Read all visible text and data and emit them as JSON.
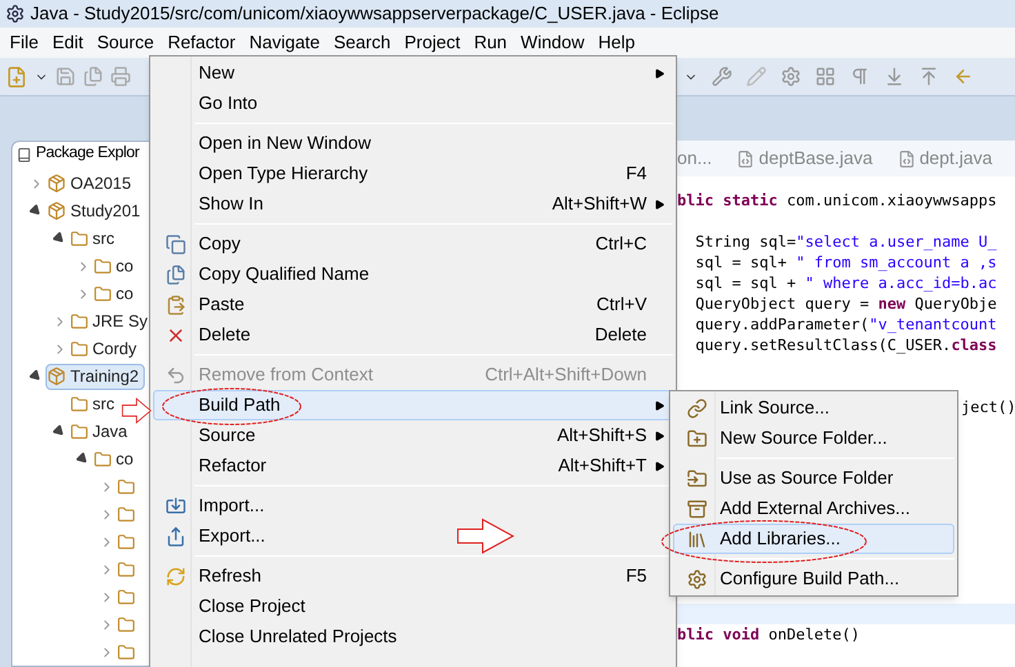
{
  "window": {
    "title": "Java - Study2015/src/com/unicom/xiaoywwsappserverpackage/C_USER.java - Eclipse"
  },
  "menu_bar": [
    "File",
    "Edit",
    "Source",
    "Refactor",
    "Navigate",
    "Search",
    "Project",
    "Run",
    "Window",
    "Help"
  ],
  "package_explorer": {
    "title": "Package Explor",
    "tree": [
      {
        "label": "OA2015",
        "expanded": false,
        "selected": false
      },
      {
        "label": "Study201",
        "expanded": true,
        "selected": false,
        "children": [
          {
            "label": "src",
            "expanded": true,
            "selected": false,
            "children": [
              {
                "label": "co",
                "expanded": false,
                "selected": false
              },
              {
                "label": "co",
                "expanded": false,
                "selected": false
              }
            ]
          },
          {
            "label": "JRE Sy",
            "expanded": false,
            "selected": false
          },
          {
            "label": "Cordy",
            "expanded": false,
            "selected": false
          }
        ]
      },
      {
        "label": "Training2",
        "expanded": true,
        "selected": true,
        "children": [
          {
            "label": "src",
            "selected": false
          },
          {
            "label": "Java",
            "expanded": true,
            "selected": false,
            "children": [
              {
                "label": "co",
                "expanded": true,
                "selected": false,
                "children": [
                  {
                    "expanded": false,
                    "selected": false
                  },
                  {
                    "expanded": false,
                    "selected": false
                  },
                  {
                    "expanded": false,
                    "selected": false
                  },
                  {
                    "expanded": false,
                    "selected": false
                  },
                  {
                    "expanded": false,
                    "selected": false
                  },
                  {
                    "expanded": false,
                    "selected": false
                  },
                  {
                    "expanded": false,
                    "selected": false
                  }
                ]
              }
            ]
          }
        ]
      }
    ]
  },
  "editor": {
    "tabs": [
      {
        "label": "on...",
        "kind": "partial"
      },
      {
        "label": "deptBase.java",
        "kind": "file"
      },
      {
        "label": "dept.java",
        "kind": "file"
      }
    ],
    "lines": [
      {
        "kind": "code",
        "segments": [
          {
            "kind": "keyword",
            "text": "blic static"
          },
          {
            "kind": "plain",
            "text": " com.unicom.xiaoywwsapps"
          }
        ]
      },
      {
        "kind": "blank",
        "current": false
      },
      {
        "kind": "code",
        "segments": [
          {
            "kind": "plain",
            "text": "  String sql="
          },
          {
            "kind": "string",
            "text": "\"select a.user_name U_"
          }
        ]
      },
      {
        "kind": "code",
        "segments": [
          {
            "kind": "plain",
            "text": "  sql = sql+ "
          },
          {
            "kind": "string",
            "text": "\" from sm_account a ,s"
          }
        ]
      },
      {
        "kind": "code",
        "segments": [
          {
            "kind": "plain",
            "text": "  sql = sql + "
          },
          {
            "kind": "string",
            "text": "\" where a.acc_id=b.ac"
          }
        ]
      },
      {
        "kind": "code",
        "segments": [
          {
            "kind": "plain",
            "text": "  QueryObject query = "
          },
          {
            "kind": "keyword",
            "text": "new"
          },
          {
            "kind": "plain",
            "text": " QueryObje"
          }
        ]
      },
      {
        "kind": "code",
        "segments": [
          {
            "kind": "plain",
            "text": "  query.addParameter("
          },
          {
            "kind": "string",
            "text": "\"v_tenantcount"
          }
        ]
      },
      {
        "kind": "code",
        "segments": [
          {
            "kind": "plain",
            "text": "  query.setResultClass(C_USER."
          },
          {
            "kind": "keyword",
            "text": "class"
          }
        ]
      },
      {
        "kind": "blank",
        "current": false
      },
      {
        "kind": "blank",
        "current": false
      },
      {
        "kind": "tail",
        "segments": [
          {
            "kind": "plain",
            "text": "ject()"
          }
        ]
      },
      {
        "kind": "blank",
        "current": false
      },
      {
        "kind": "blank",
        "current": false
      },
      {
        "kind": "blank",
        "current": false
      },
      {
        "kind": "blank",
        "current": false
      },
      {
        "kind": "blank",
        "current": false
      },
      {
        "kind": "blank",
        "current": false
      },
      {
        "kind": "blank",
        "current": false
      },
      {
        "kind": "blank",
        "current": false
      },
      {
        "kind": "blank",
        "current": false
      },
      {
        "kind": "blank",
        "current": true
      },
      {
        "kind": "code",
        "segments": [
          {
            "kind": "keyword",
            "text": "blic void"
          },
          {
            "kind": "plain",
            "text": " onDelete()"
          }
        ]
      }
    ]
  },
  "context_menu": {
    "groups": [
      [
        {
          "label": "New",
          "submenu": true,
          "disabled": false,
          "selected": false
        },
        {
          "label": "Go Into",
          "submenu": false,
          "disabled": false,
          "selected": false
        }
      ],
      [
        {
          "label": "Open in New Window",
          "submenu": false,
          "disabled": false,
          "selected": false
        },
        {
          "label": "Open Type Hierarchy",
          "shortcut": "F4",
          "submenu": false,
          "disabled": false,
          "selected": false
        },
        {
          "label": "Show In",
          "shortcut": "Alt+Shift+W",
          "submenu": true,
          "disabled": false,
          "selected": false
        }
      ],
      [
        {
          "label": "Copy",
          "shortcut": "Ctrl+C",
          "submenu": false,
          "disabled": false,
          "selected": false
        },
        {
          "label": "Copy Qualified Name",
          "submenu": false,
          "disabled": false,
          "selected": false
        },
        {
          "label": "Paste",
          "shortcut": "Ctrl+V",
          "submenu": false,
          "disabled": false,
          "selected": false
        },
        {
          "label": "Delete",
          "shortcut": "Delete",
          "submenu": false,
          "disabled": false,
          "selected": false
        }
      ],
      [
        {
          "label": "Remove from Context",
          "shortcut": "Ctrl+Alt+Shift+Down",
          "submenu": false,
          "disabled": true,
          "selected": false
        },
        {
          "label": "Build Path",
          "submenu": true,
          "disabled": false,
          "selected": true
        },
        {
          "label": "Source",
          "shortcut": "Alt+Shift+S",
          "submenu": true,
          "disabled": false,
          "selected": false
        },
        {
          "label": "Refactor",
          "shortcut": "Alt+Shift+T",
          "submenu": true,
          "disabled": false,
          "selected": false
        }
      ],
      [
        {
          "label": "Import...",
          "submenu": false,
          "disabled": false,
          "selected": false
        },
        {
          "label": "Export...",
          "submenu": false,
          "disabled": false,
          "selected": false
        }
      ],
      [
        {
          "label": "Refresh",
          "shortcut": "F5",
          "submenu": false,
          "disabled": false,
          "selected": false
        },
        {
          "label": "Close Project",
          "submenu": false,
          "disabled": false,
          "selected": false
        },
        {
          "label": "Close Unrelated Projects",
          "submenu": false,
          "disabled": false,
          "selected": false
        }
      ]
    ]
  },
  "build_path_submenu": {
    "groups": [
      [
        {
          "label": "Link Source...",
          "selected": false
        },
        {
          "label": "New Source Folder...",
          "selected": false
        }
      ],
      [
        {
          "label": "Use as Source Folder",
          "selected": false
        },
        {
          "label": "Add External Archives...",
          "selected": false
        },
        {
          "label": "Add Libraries...",
          "selected": true
        }
      ],
      [
        {
          "label": "Configure Build Path...",
          "selected": false
        }
      ]
    ]
  }
}
